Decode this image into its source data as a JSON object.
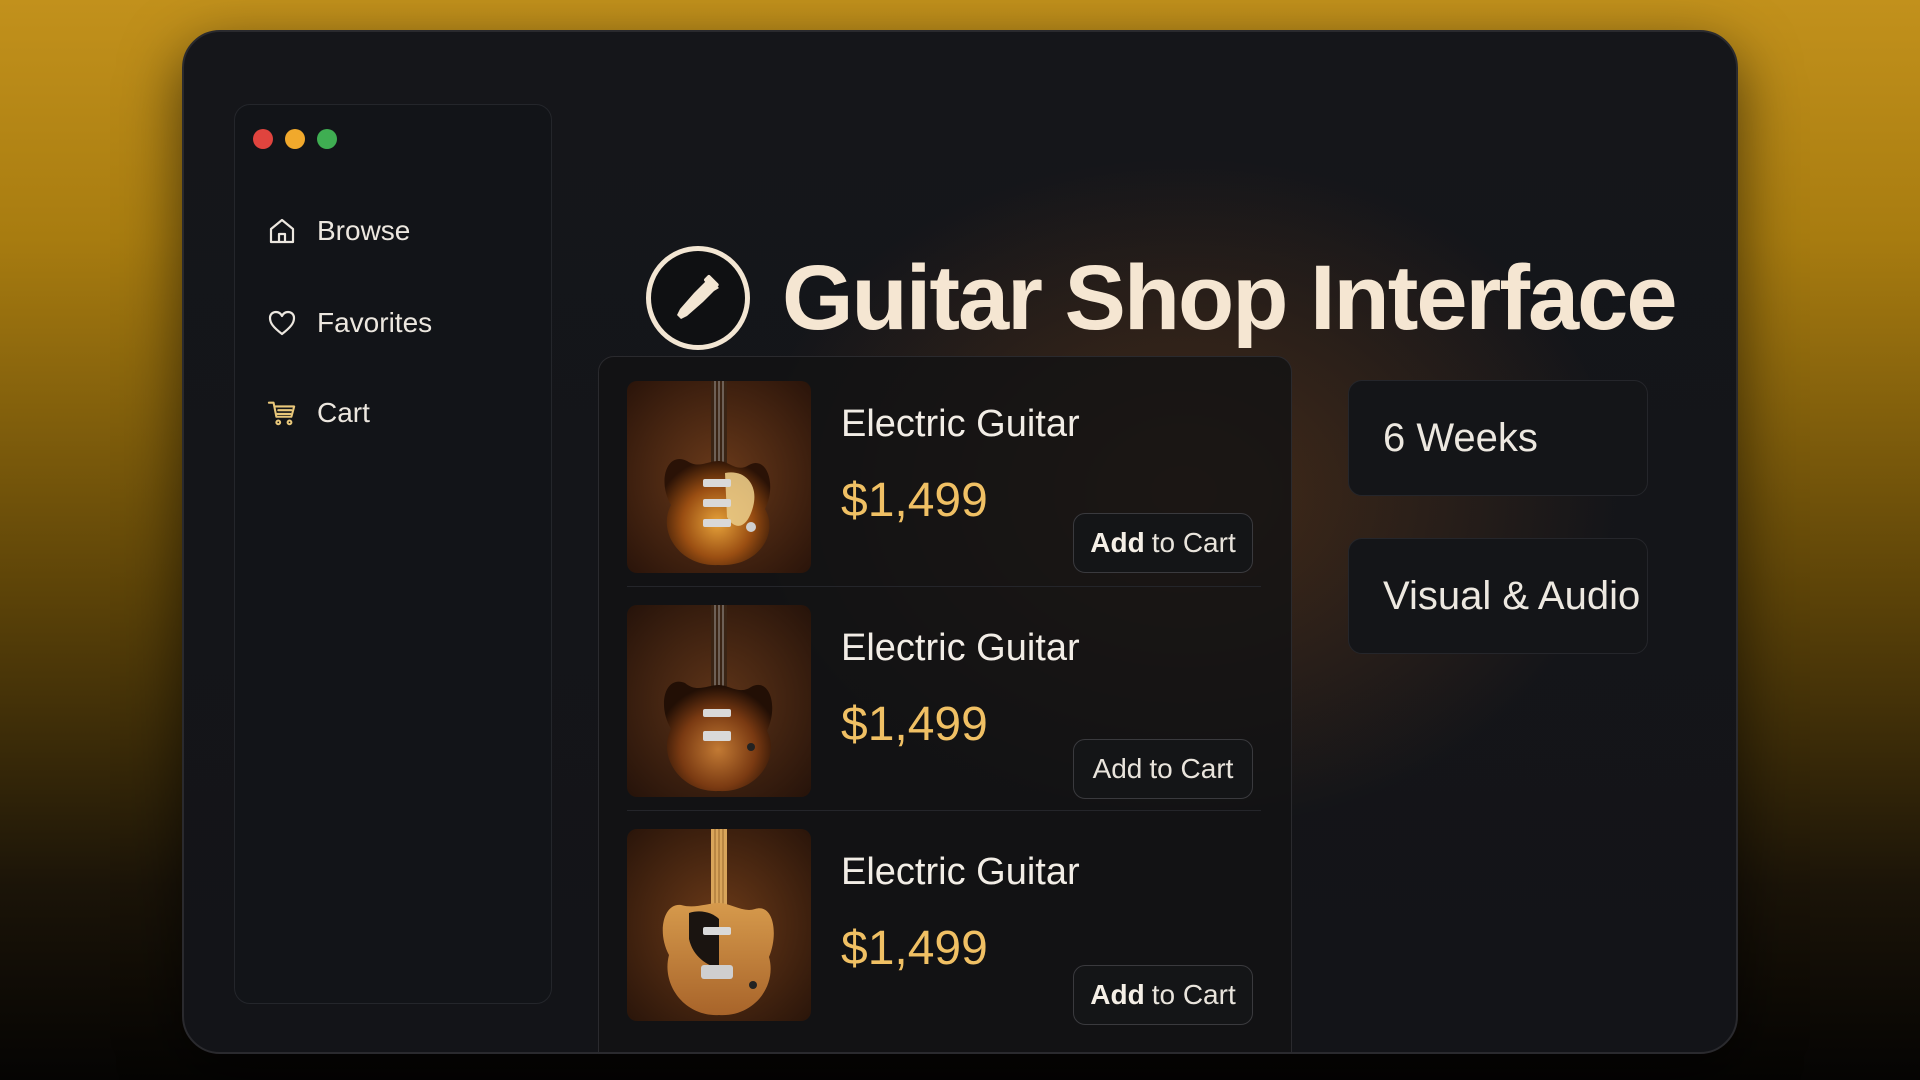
{
  "window": {
    "controls": [
      "close",
      "minimize",
      "zoom"
    ],
    "control_colors": {
      "close": "#e0443e",
      "minimize": "#f1a92c",
      "zoom": "#3fae52"
    }
  },
  "sidebar": {
    "items": [
      {
        "label": "Browse",
        "icon": "home-icon"
      },
      {
        "label": "Favorites",
        "icon": "heart-icon"
      },
      {
        "label": "Cart",
        "icon": "cart-icon"
      }
    ]
  },
  "header": {
    "title": "Guitar Shop Interface",
    "logo_icon": "guitar-pick-icon"
  },
  "products": [
    {
      "name": "Electric Guitar",
      "price": "$1,499",
      "button_bold": "Add",
      "button_rest": "to Cart",
      "finish": "sunburst"
    },
    {
      "name": "Electric Guitar",
      "price": "$1,499",
      "button_bold": "Add",
      "button_rest": "to Cart",
      "finish": "sunburst"
    },
    {
      "name": "Electric Guitar",
      "price": "$1,499",
      "button_bold": "Add",
      "button_rest": "to Cart",
      "finish": "natural"
    }
  ],
  "info_cards": [
    {
      "label": "6 Weeks"
    },
    {
      "label": "Visual & Audio"
    }
  ],
  "colors": {
    "accent_price": "#f0c064",
    "title": "#f5e6d2",
    "background_gold": "#c2911c"
  }
}
